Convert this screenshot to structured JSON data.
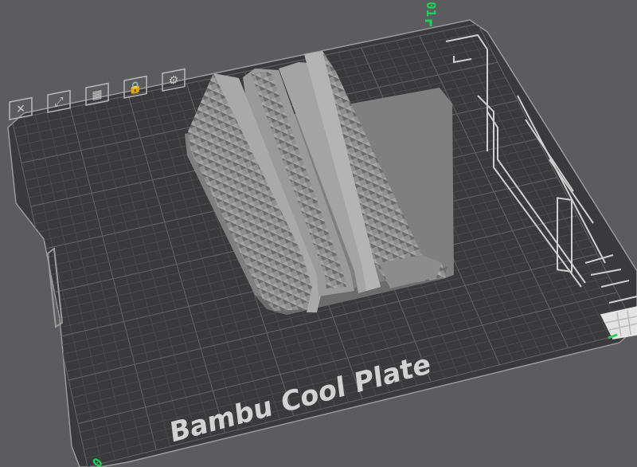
{
  "plate": {
    "name": "Bambu Cool Plate",
    "surface_color": "#3a3a3c",
    "grid_color": "#4d4d50",
    "major_grid_color": "#5e5e62",
    "border_color": "#9a9a9a",
    "background_color": "#5c5c5e"
  },
  "axis_labels": {
    "x_origin": "0",
    "y_top": "01",
    "color": "#1fd15a"
  },
  "toolbar": {
    "tools": [
      {
        "name": "delete-plate-icon",
        "icon": "✕"
      },
      {
        "name": "orient-plate-icon",
        "icon": "⤢"
      },
      {
        "name": "arrange-plate-icon",
        "icon": "▦"
      },
      {
        "name": "lock-plate-icon",
        "icon": "🔒"
      },
      {
        "name": "plate-settings-icon",
        "icon": "⚙"
      }
    ]
  },
  "model": {
    "description_color": "#8e8e8e",
    "shadow_color": "#6a6a6a"
  }
}
